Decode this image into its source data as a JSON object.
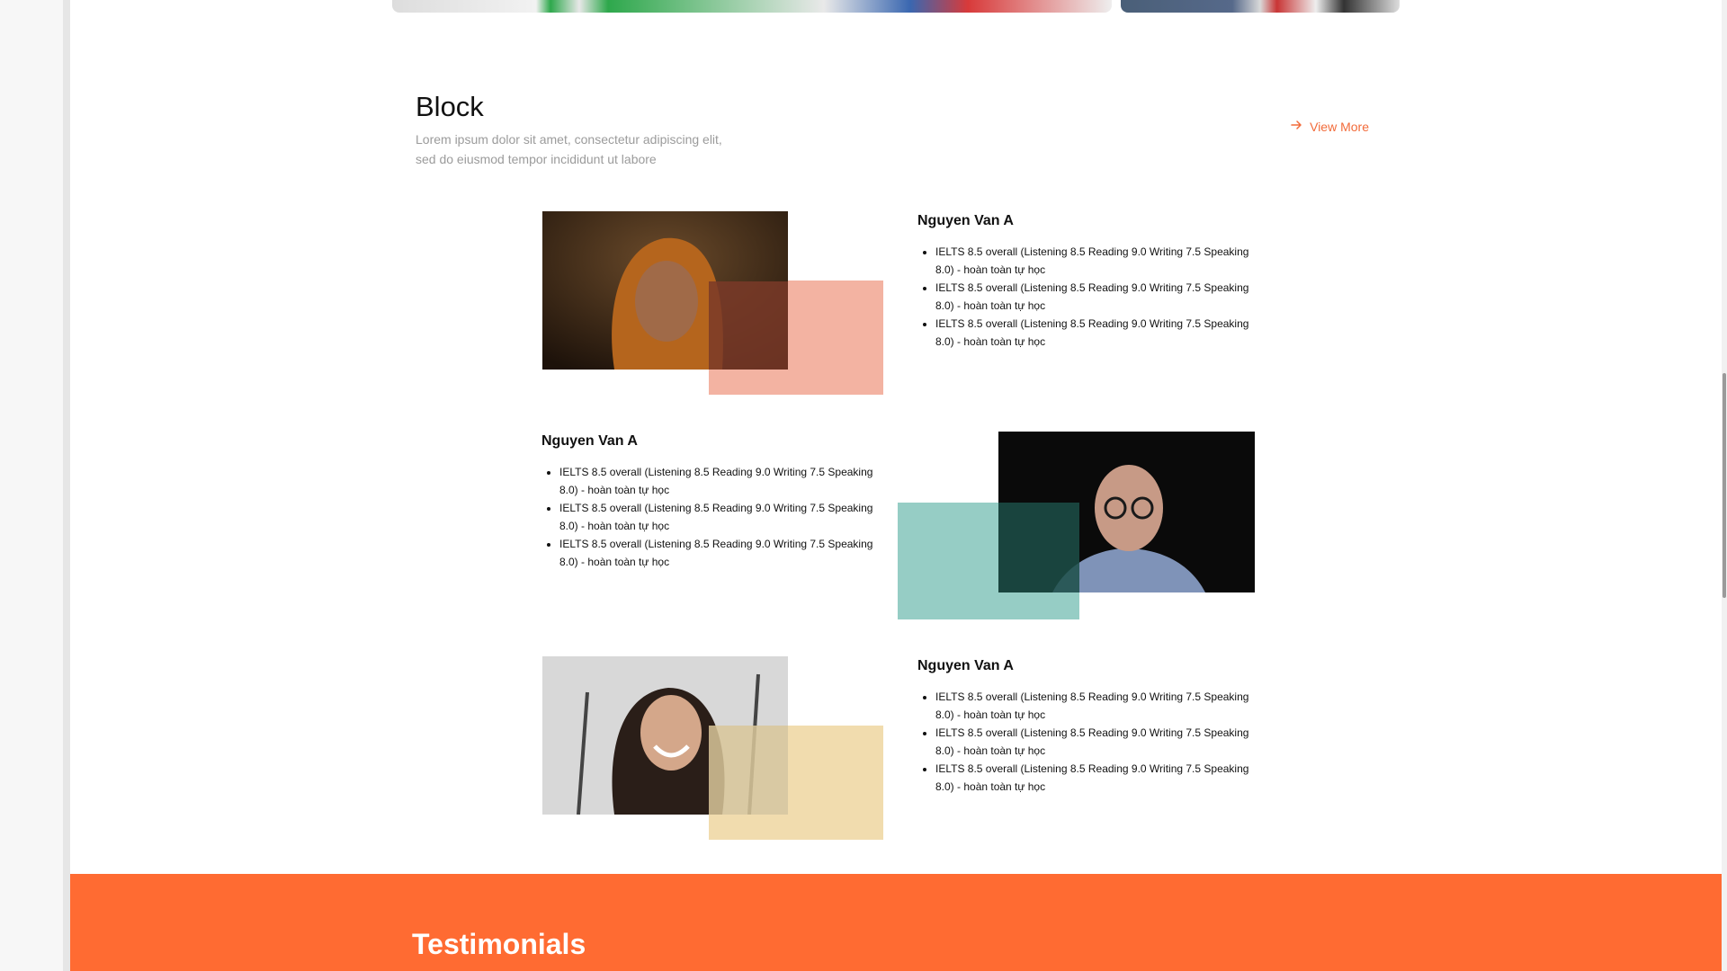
{
  "section": {
    "title": "Block",
    "subtitle": "Lorem ipsum dolor sit amet, consectetur adipiscing elit, sed do eiusmod tempor incididunt ut labore",
    "view_more": "View More"
  },
  "cards": [
    {
      "name": "Nguyen Van A",
      "accent_color": "#f0a08b",
      "items": [
        "IELTS 8.5 overall (Listening 8.5 Reading 9.0 Writing 7.5 Speaking 8.0) - hoàn toàn tự học",
        "IELTS 8.5 overall (Listening 8.5 Reading 9.0 Writing 7.5 Speaking 8.0) - hoàn toàn tự học",
        "IELTS 8.5 overall (Listening 8.5 Reading 9.0 Writing 7.5 Speaking 8.0) - hoàn toàn tự học"
      ]
    },
    {
      "name": "Nguyen Van A",
      "accent_color": "#7cc1b6",
      "items": [
        "IELTS 8.5 overall (Listening 8.5 Reading 9.0 Writing 7.5 Speaking 8.0) - hoàn toàn tự học",
        "IELTS 8.5 overall (Listening 8.5 Reading 9.0 Writing 7.5 Speaking 8.0) - hoàn toàn tự học",
        "IELTS 8.5 overall (Listening 8.5 Reading 9.0 Writing 7.5 Speaking 8.0) - hoàn toàn tự học"
      ]
    },
    {
      "name": "Nguyen Van A",
      "accent_color": "#efd6a0",
      "items": [
        "IELTS 8.5 overall (Listening 8.5 Reading 9.0 Writing 7.5 Speaking 8.0) - hoàn toàn tự học",
        "IELTS 8.5 overall (Listening 8.5 Reading 9.0 Writing 7.5 Speaking 8.0) - hoàn toàn tự học",
        "IELTS 8.5 overall (Listening 8.5 Reading 9.0 Writing 7.5 Speaking 8.0) - hoàn toàn tự học"
      ]
    }
  ],
  "testimonials": {
    "title": "Testimonials"
  },
  "colors": {
    "brand_orange": "#ff6b32",
    "link_orange": "#f26b3a"
  }
}
